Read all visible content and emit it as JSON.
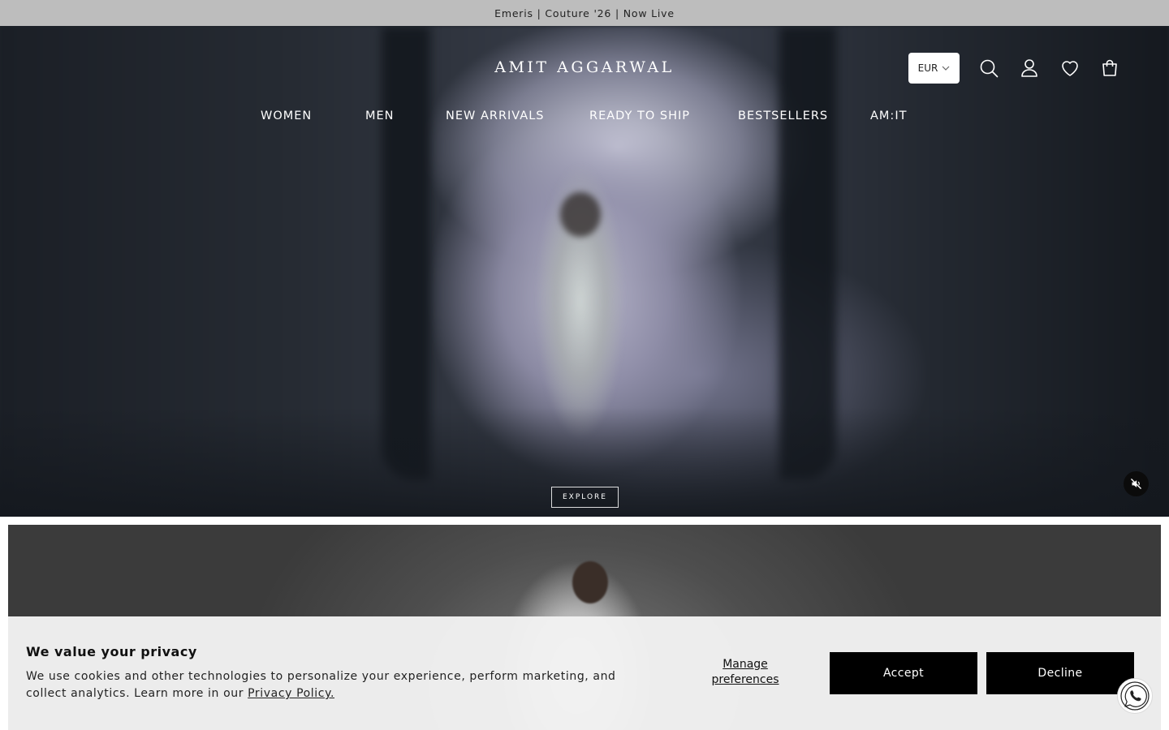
{
  "announcement": {
    "text": "Emeris | Couture '26 | Now Live"
  },
  "header": {
    "logo": "AMIT AGGARWAL",
    "currency": "EUR",
    "icons": [
      "search-icon",
      "account-icon",
      "wishlist-heart-icon",
      "cart-bag-icon"
    ]
  },
  "nav": {
    "items": [
      {
        "label": "WOMEN"
      },
      {
        "label": "MEN"
      },
      {
        "label": "NEW ARRIVALS"
      },
      {
        "label": "READY TO SHIP"
      },
      {
        "label": "BESTSELLERS"
      },
      {
        "label": "AM:IT"
      }
    ]
  },
  "hero": {
    "cta": "EXPLORE",
    "mute_icon": "volume-muted-icon"
  },
  "cookie": {
    "title": "We value your privacy",
    "body": "We use cookies and other technologies to personalize your experience, perform marketing, and collect analytics. Learn more in our",
    "link": "Privacy Policy.",
    "manage": "Manage preferences",
    "accept": "Accept",
    "decline": "Decline"
  },
  "chat": {
    "icon": "whatsapp-icon"
  },
  "colors": {
    "announce_bg": "#bdbdbd",
    "button_bg": "#000000",
    "banner_bg": "#f2f2f2"
  }
}
